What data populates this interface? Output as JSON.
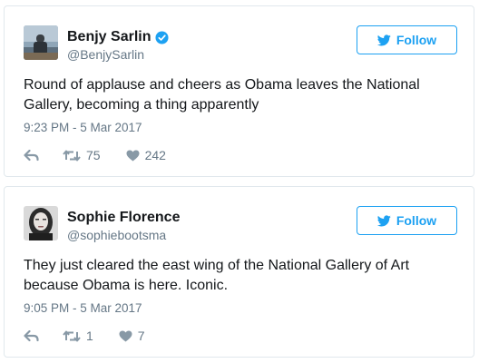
{
  "colors": {
    "accent": "#1da1f2",
    "text": "#14171a",
    "muted": "#657786",
    "border": "#e1e8ed"
  },
  "tweets": [
    {
      "name": "Benjy Sarlin",
      "handle": "@BenjySarlin",
      "verified": true,
      "follow_label": "Follow",
      "text": "Round of applause and cheers as Obama leaves the National Gallery, becoming a thing apparently",
      "timestamp": "9:23 PM - 5 Mar 2017",
      "retweets": "75",
      "likes": "242"
    },
    {
      "name": "Sophie Florence",
      "handle": "@sophiebootsma",
      "verified": false,
      "follow_label": "Follow",
      "text": "They just cleared the east wing of the National Gallery of Art because Obama is here. Iconic.",
      "timestamp": "9:05 PM - 5 Mar 2017",
      "retweets": "1",
      "likes": "7"
    }
  ]
}
